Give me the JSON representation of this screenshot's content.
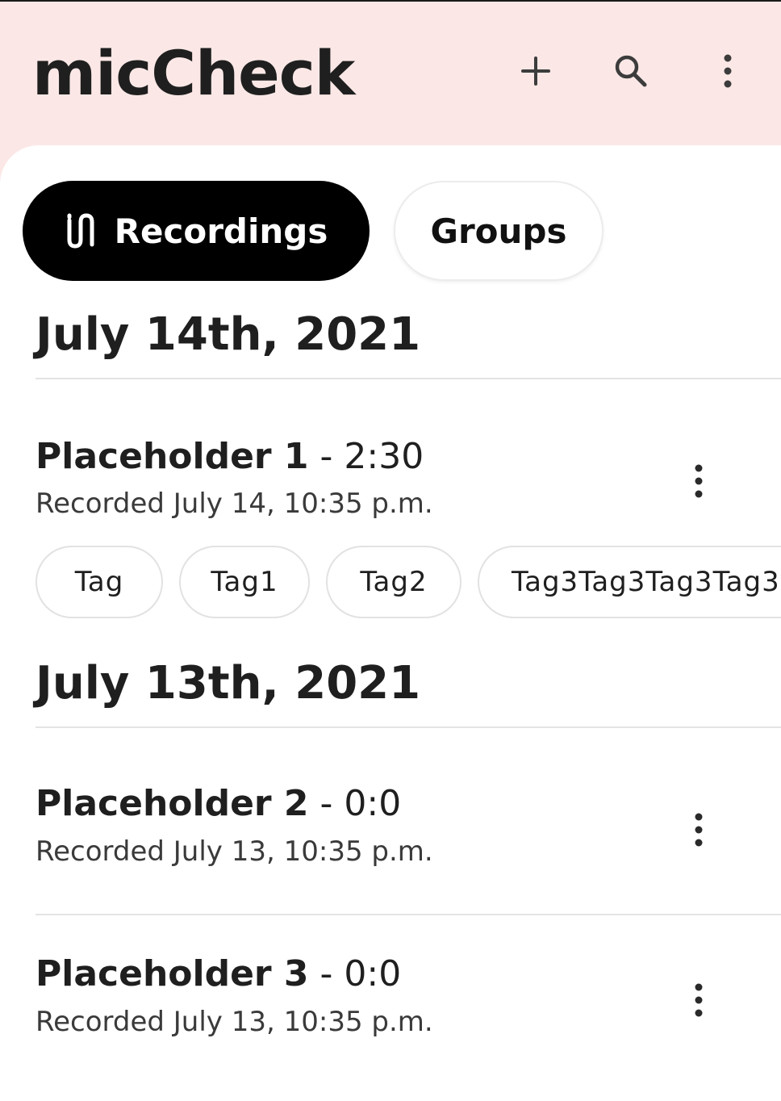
{
  "app": {
    "title": "micCheck"
  },
  "header": {
    "actions": [
      {
        "icon": "plus-icon"
      },
      {
        "icon": "search-icon"
      },
      {
        "icon": "more-vertical-icon"
      }
    ]
  },
  "tabs": [
    {
      "label": "Recordings",
      "icon": "recordings-icon",
      "selected": true
    },
    {
      "label": "Groups",
      "selected": false
    }
  ],
  "sections": [
    {
      "date": "July 14th, 2021",
      "recordings": [
        {
          "name": "Placeholder 1",
          "separator": " - ",
          "duration": "2:30",
          "recorded": "Recorded July 14, 10:35 p.m.",
          "tags": [
            "Tag",
            "Tag1",
            "Tag2",
            "Tag3Tag3Tag3Tag3"
          ]
        }
      ]
    },
    {
      "date": "July 13th, 2021",
      "recordings": [
        {
          "name": "Placeholder 2",
          "separator": " - ",
          "duration": "0:0",
          "recorded": "Recorded July 13, 10:35 p.m."
        },
        {
          "name": "Placeholder 3",
          "separator": " - ",
          "duration": "0:0",
          "recorded": "Recorded July 13, 10:35 p.m."
        }
      ]
    }
  ],
  "colors": {
    "header_bg": "#fbe8e6",
    "surface": "#ffffff",
    "selected_chip": "#000000",
    "text": "#1f1f1f"
  }
}
